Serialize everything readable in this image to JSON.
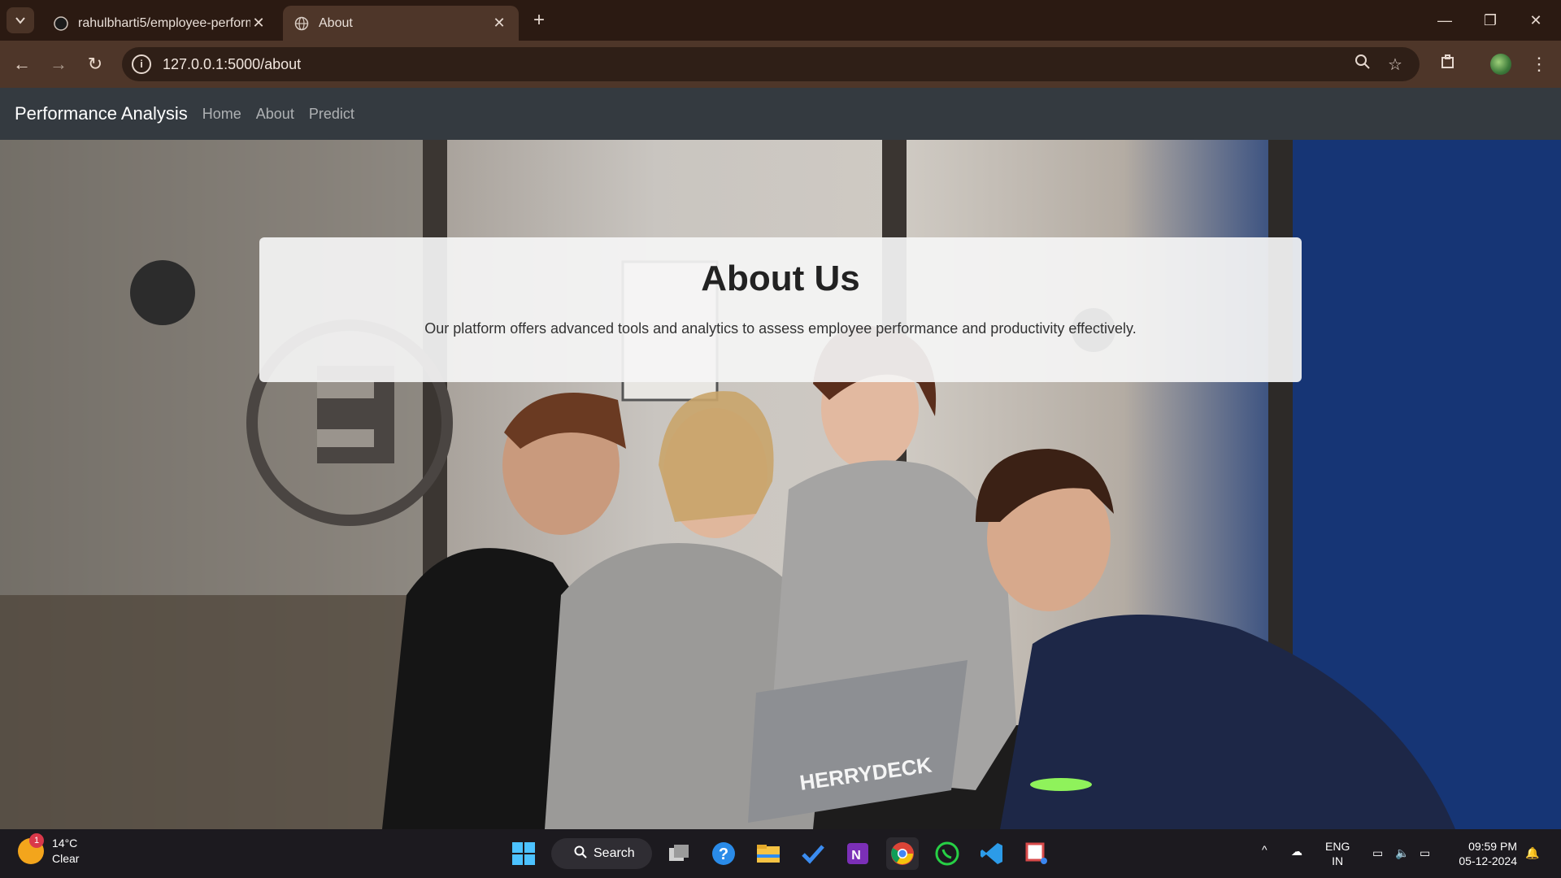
{
  "browser": {
    "tabs": [
      {
        "title": "rahulbharti5/employee-perform",
        "active": false,
        "icon": "github-icon"
      },
      {
        "title": "About",
        "active": true,
        "icon": "globe-icon"
      }
    ],
    "address": "127.0.0.1:5000/about"
  },
  "site": {
    "brand": "Performance Analysis",
    "nav": [
      "Home",
      "About",
      "Predict"
    ]
  },
  "about": {
    "heading": "About Us",
    "text": "Our platform offers advanced tools and analytics to assess employee performance and productivity effectively."
  },
  "taskbar": {
    "weather_temp": "14°C",
    "weather_cond": "Clear",
    "weather_badge": "1",
    "search_label": "Search",
    "lang_top": "ENG",
    "lang_bottom": "IN",
    "time": "09:59 PM",
    "date": "05-12-2024"
  },
  "hero_image": {
    "description_icon": "team-photo-background",
    "laptop_sticker": "HERRYDECK"
  }
}
